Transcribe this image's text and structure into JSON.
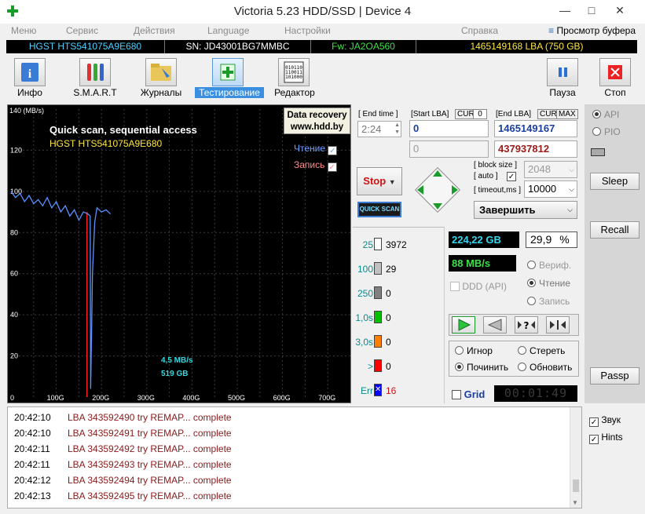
{
  "window": {
    "title": "Victoria 5.23 HDD/SSD | Device 4"
  },
  "menu": {
    "items": [
      "Меню",
      "Сервис",
      "Действия",
      "Language",
      "Настройки",
      "Справка"
    ],
    "buffer_label": "Просмотр буфера"
  },
  "info": {
    "model": "HGST HTS541075A9E680",
    "serial": "SN: JD43001BG7MMBC",
    "firmware": "Fw: JA2OA560",
    "capacity": "1465149168 LBA (750 GB)"
  },
  "toolbar": {
    "info": "Инфо",
    "smart": "S.M.A.R.T",
    "logs": "Журналы",
    "testing": "Тестирование",
    "editor": "Редактор",
    "pause": "Пауза",
    "stop": "Стоп"
  },
  "graph": {
    "y_unit": "140 (MB/s)",
    "title": "Quick scan, sequential access",
    "model": "HGST HTS541075A9E680",
    "badge_line1": "Data recovery",
    "badge_line2": "www.hdd.by",
    "read_label": "Чтение",
    "write_label": "Запись",
    "speed_label": "4,5 MB/s",
    "size_label": "519 GB"
  },
  "chart_data": {
    "type": "line",
    "title": "Quick scan, sequential access",
    "ylabel": "140 (MB/s)",
    "xlabel": "",
    "ylim": [
      0,
      140
    ],
    "xlim": [
      0,
      750
    ],
    "x_ticks": [
      "0",
      "100G",
      "200G",
      "300G",
      "400G",
      "500G",
      "600G",
      "700G"
    ],
    "y_ticks": [
      "20",
      "40",
      "60",
      "80",
      "100",
      "120"
    ],
    "series": [
      {
        "name": "Чтение",
        "x": [
          0,
          10,
          20,
          30,
          40,
          50,
          60,
          70,
          80,
          90,
          100,
          110,
          120,
          130,
          140,
          150,
          160,
          170,
          175,
          176,
          178,
          180,
          185,
          190,
          200,
          210,
          220
        ],
        "y": [
          100,
          97,
          99,
          95,
          98,
          94,
          96,
          93,
          97,
          92,
          95,
          90,
          93,
          88,
          91,
          86,
          90,
          89,
          88,
          4,
          30,
          60,
          85,
          92,
          90,
          91,
          89
        ]
      }
    ],
    "marker": {
      "x": 168,
      "label": "519 GB"
    }
  },
  "test": {
    "end_time_label": "[ End time ]",
    "end_time_value": "2:24",
    "start_lba_label": "[Start LBA]",
    "cur_label": "CUR",
    "start_cur_value": "0",
    "start_lba_value": "0",
    "start_lba_current": "0",
    "end_lba_label": "[End LBA]",
    "max_label": "MAX",
    "end_lba_value": "1465149167",
    "end_lba_current": "437937812",
    "stop_button": "Stop",
    "quick_scan": "QUICK SCAN",
    "block_size_label": "[ block size ]",
    "auto_label": "[ auto ]",
    "block_size_value": "2048",
    "timeout_label": "[ timeout,ms ]",
    "timeout_value": "10000",
    "finish_select": "Завершить"
  },
  "blocks": [
    {
      "label": "25",
      "count": "3972",
      "color": "#ffffff"
    },
    {
      "label": "100",
      "count": "29",
      "color": "#c0c0c0"
    },
    {
      "label": "250",
      "count": "0",
      "color": "#808080"
    },
    {
      "label": "1,0s",
      "count": "0",
      "color": "#00c000"
    },
    {
      "label": "3,0s",
      "count": "0",
      "color": "#ff8000"
    },
    {
      "label": ">",
      "count": "0",
      "color": "#ff0000"
    },
    {
      "label": "Err",
      "count": "16",
      "color": "#0000ff"
    }
  ],
  "stats": {
    "processed": "224,22 GB",
    "percent": "29,9",
    "percent_unit": "%",
    "speed": "88 MB/s",
    "ddd": "DDD (API)"
  },
  "mode": {
    "verify": "Вериф.",
    "read": "Чтение",
    "write": "Запись"
  },
  "repair": {
    "ignore": "Игнор",
    "erase": "Стереть",
    "fix": "Починить",
    "update": "Обновить"
  },
  "grid": {
    "label": "Grid",
    "timer": "00:01:49"
  },
  "side": {
    "api": "API",
    "pio": "PIO",
    "sleep": "Sleep",
    "recall": "Recall",
    "passp": "Passp",
    "sound": "Звук",
    "hints": "Hints"
  },
  "log": [
    {
      "time": "20:42:10",
      "msg": "LBA 343592490 try REMAP... complete"
    },
    {
      "time": "20:42:10",
      "msg": "LBA 343592491 try REMAP... complete"
    },
    {
      "time": "20:42:11",
      "msg": "LBA 343592492 try REMAP... complete"
    },
    {
      "time": "20:42:11",
      "msg": "LBA 343592493 try REMAP... complete"
    },
    {
      "time": "20:42:12",
      "msg": "LBA 343592494 try REMAP... complete"
    },
    {
      "time": "20:42:13",
      "msg": "LBA 343592495 try REMAP... complete"
    }
  ]
}
